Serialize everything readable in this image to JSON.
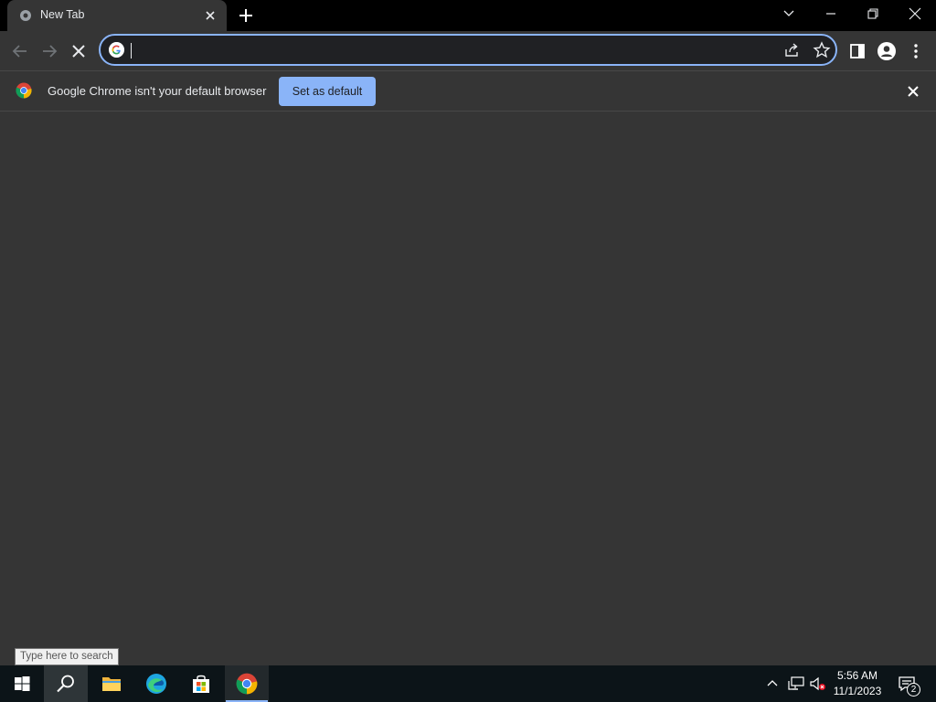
{
  "browser": {
    "tab": {
      "title": "New Tab"
    },
    "omnibox": {
      "value": "",
      "placeholder": ""
    },
    "infobar": {
      "message": "Google Chrome isn't your default browser",
      "button_label": "Set as default"
    }
  },
  "taskbar": {
    "search_tooltip": "Type here to search",
    "apps": [
      "start",
      "search",
      "file-explorer",
      "edge",
      "microsoft-store",
      "chrome"
    ],
    "clock": {
      "time": "5:56 AM",
      "date": "11/1/2023"
    },
    "notifications_count": "2"
  },
  "colors": {
    "accent": "#8ab4f8",
    "page_bg": "#353535",
    "titlebar_bg": "#000000",
    "taskbar_bg": "#0c1418"
  }
}
